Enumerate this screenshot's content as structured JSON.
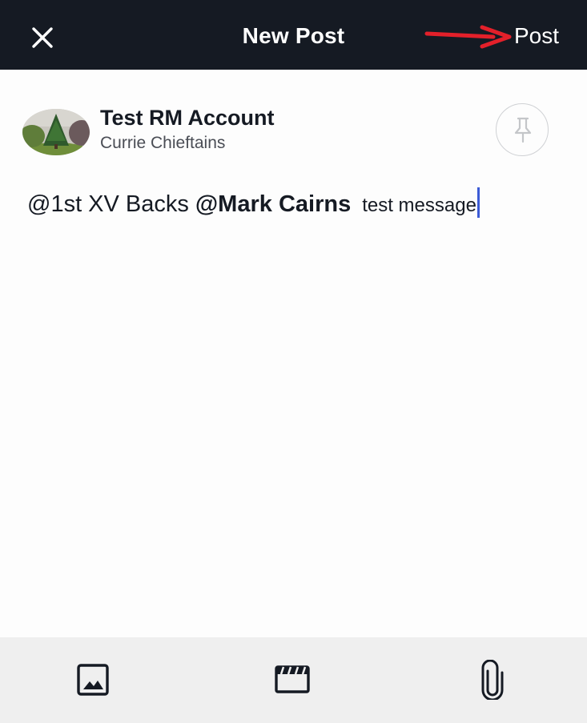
{
  "header": {
    "title": "New Post",
    "post_label": "Post",
    "close_icon": "close-icon",
    "annotation_color": "#e3202a"
  },
  "account": {
    "name": "Test RM Account",
    "team": "Currie Chieftains",
    "pin_icon": "pin-icon"
  },
  "message": {
    "mention_group": "@1st XV Backs",
    "mention_user": "@Mark Cairns",
    "text": "test message",
    "caret_color": "#3c5bd6"
  },
  "toolbar": {
    "items": [
      "image-icon",
      "video-icon",
      "attachment-icon"
    ]
  }
}
